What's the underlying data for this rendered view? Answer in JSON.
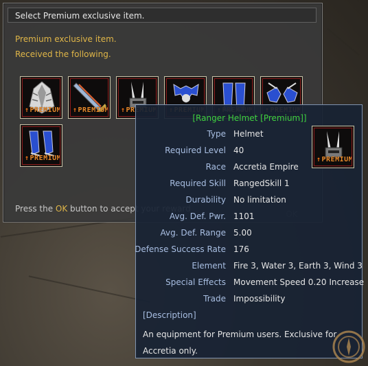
{
  "dialog": {
    "title": "Select Premium exclusive item.",
    "message_line1": "Premium exclusive item.",
    "message_line2": "Received the following.",
    "footer_prefix": "Press the ",
    "footer_ok": "OK",
    "footer_suffix": " button to accept your reward",
    "ok_button": "OK",
    "premium_label": "PREMIUM",
    "items": [
      {
        "icon": "cape-icon"
      },
      {
        "icon": "sword-icon"
      },
      {
        "icon": "helmet-icon"
      },
      {
        "icon": "armor-icon"
      },
      {
        "icon": "leg-armor-icon"
      },
      {
        "icon": "gloves-icon"
      },
      {
        "icon": "boots-icon"
      }
    ]
  },
  "tooltip": {
    "title": "[Ranger Helmet [Premium]]",
    "rows": [
      {
        "label": "Type",
        "value": "Helmet"
      },
      {
        "label": "Required Level",
        "value": "40"
      },
      {
        "label": "Race",
        "value": "Accretia Empire"
      },
      {
        "label": "Required Skill",
        "value": "RangedSkill 1"
      },
      {
        "label": "Durability",
        "value": "No limitation"
      },
      {
        "label": "Avg. Def. Pwr.",
        "value": "1101"
      },
      {
        "label": "Avg. Def. Range",
        "value": "5.00"
      },
      {
        "label": "Defense Success Rate",
        "value": "176"
      },
      {
        "label": "Element",
        "value": "Fire 3, Water 3, Earth 3, Wind 3"
      },
      {
        "label": "Special Effects",
        "value": "Movement Speed 0.20 Increase"
      },
      {
        "label": "Trade",
        "value": "Impossibility"
      }
    ],
    "description_heading": "[Description]",
    "description": "An equipment for Premium users. Exclusive for Accretia only."
  },
  "colors": {
    "accent_gold": "#e0b648",
    "tooltip_title_green": "#3fd13f",
    "tooltip_label_blue": "#a9bfe3",
    "premium_orange": "#e88a2c"
  }
}
